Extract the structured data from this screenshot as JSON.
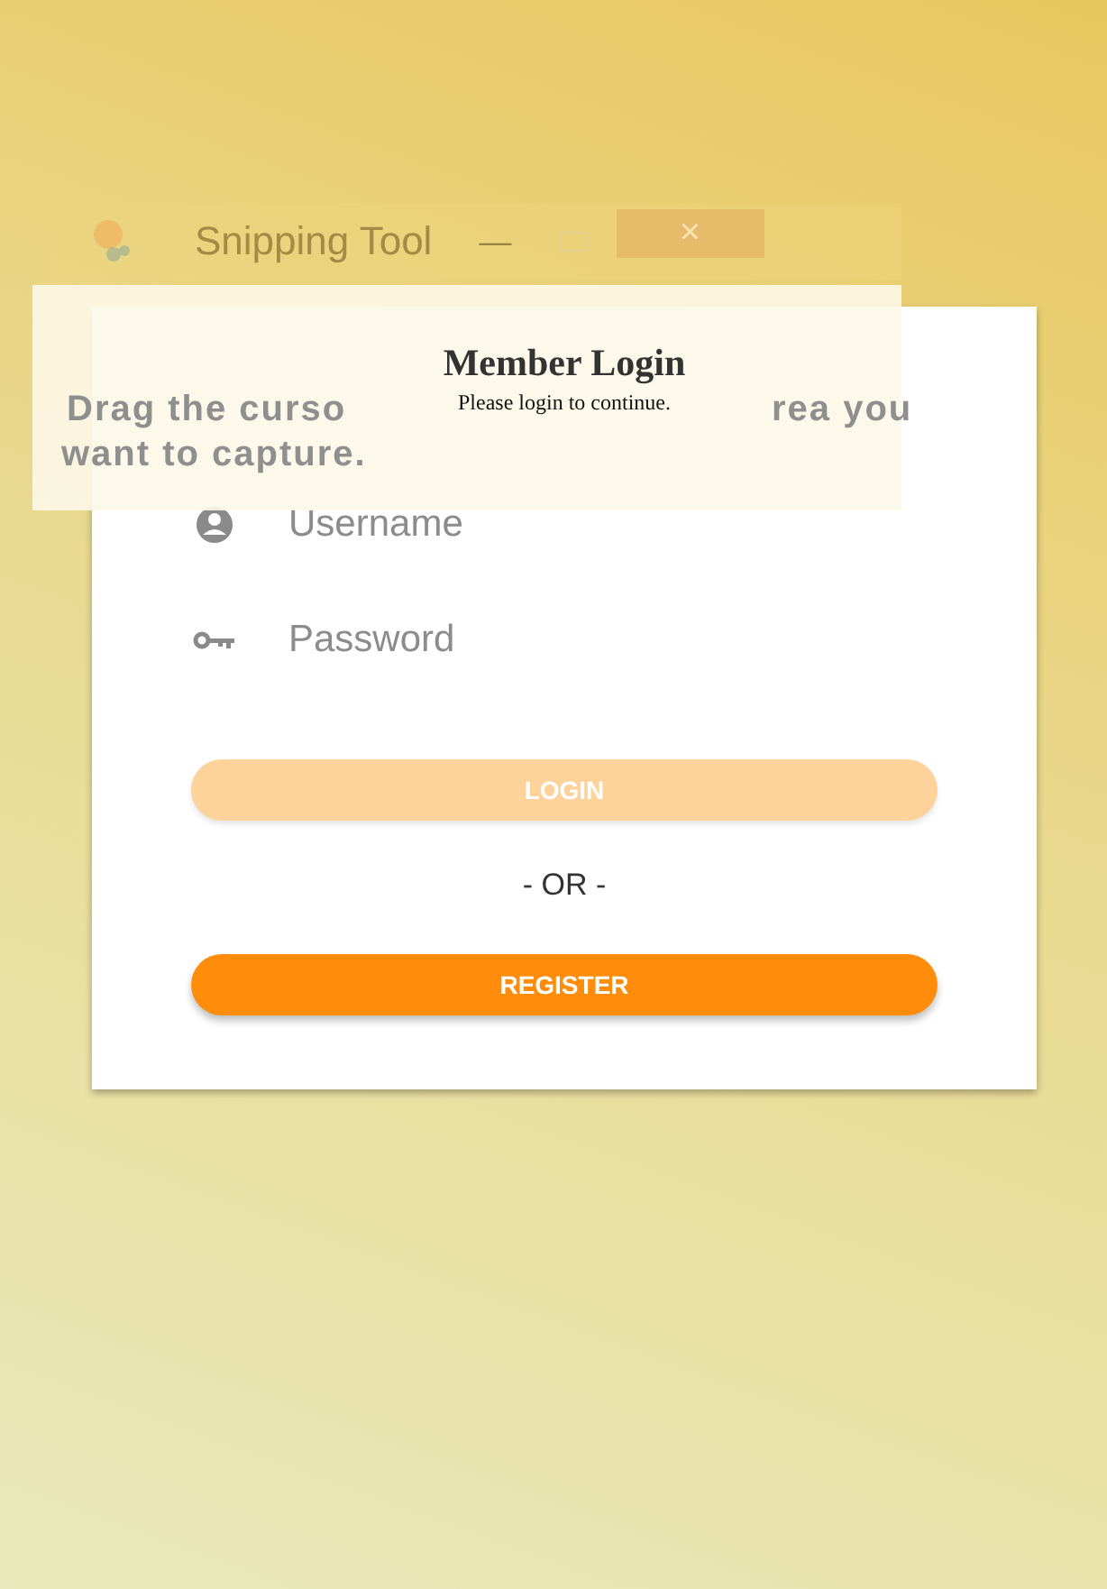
{
  "snipping_tool": {
    "title": "Snipping Tool",
    "minimize": "—",
    "close": "×",
    "hint_parts": [
      "Drag the curso",
      "rea you",
      "want to capture."
    ]
  },
  "login_card": {
    "title": "Member Login",
    "subtitle": "Please login to continue.",
    "fields": [
      {
        "kind": "user",
        "placeholder": "Username"
      },
      {
        "kind": "key",
        "placeholder": "Password"
      }
    ],
    "buttons": [
      {
        "label": "LOGIN",
        "disabled": true
      },
      {
        "label": "REGISTER",
        "disabled": false
      }
    ],
    "separator": "- OR -"
  }
}
